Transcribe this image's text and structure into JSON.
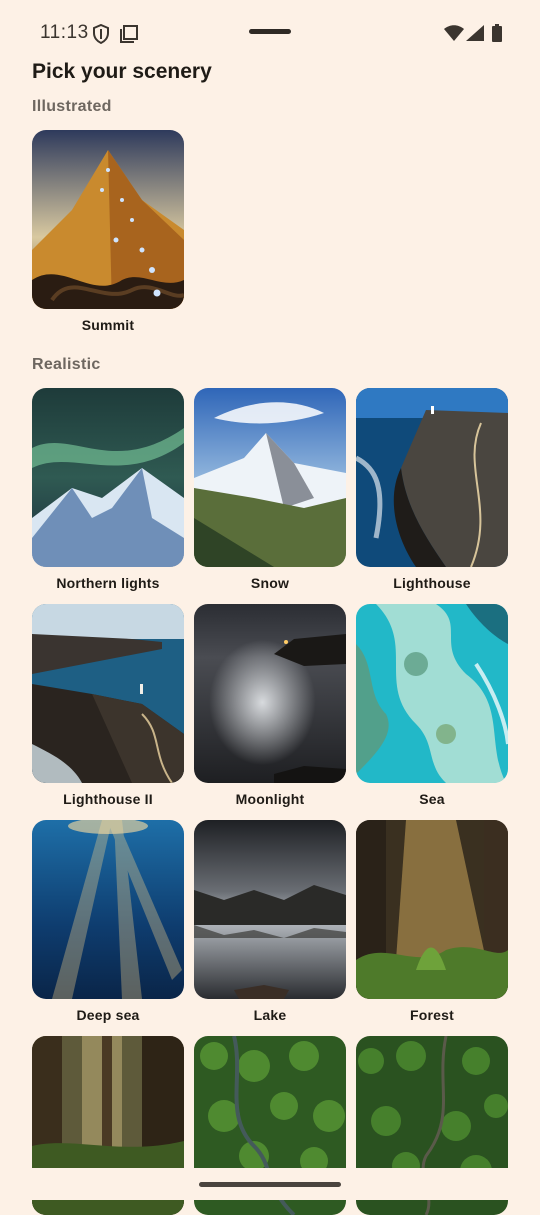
{
  "status": {
    "time": "11:13",
    "icons": [
      "shield-icon",
      "screen-icon",
      "wifi-icon",
      "signal-icon",
      "battery-icon"
    ]
  },
  "page": {
    "title": "Pick your scenery"
  },
  "sections": {
    "illustrated": {
      "label": "Illustrated",
      "items": [
        {
          "label": "Summit",
          "image": "mountain-summit-illustration"
        }
      ]
    },
    "realistic": {
      "label": "Realistic",
      "items": [
        {
          "label": "Northern lights",
          "image": "aurora-over-snowy-peaks"
        },
        {
          "label": "Snow",
          "image": "snowy-matterhorn-peak"
        },
        {
          "label": "Lighthouse",
          "image": "cliff-lighthouse-aerial"
        },
        {
          "label": "Lighthouse II",
          "image": "coastal-cliffs-lighthouse"
        },
        {
          "label": "Moonlight",
          "image": "moonlit-sea-lighthouse"
        },
        {
          "label": "Sea",
          "image": "turquoise-reef-aerial"
        },
        {
          "label": "Deep sea",
          "image": "underwater-light-rays"
        },
        {
          "label": "Lake",
          "image": "mirror-lake-mountains"
        },
        {
          "label": "Forest",
          "image": "sunlit-forest-ferns"
        },
        {
          "label": "",
          "image": "redwood-forest"
        },
        {
          "label": "",
          "image": "forest-canopy-river-aerial"
        },
        {
          "label": "",
          "image": "forest-canopy-road-aerial"
        }
      ]
    }
  }
}
